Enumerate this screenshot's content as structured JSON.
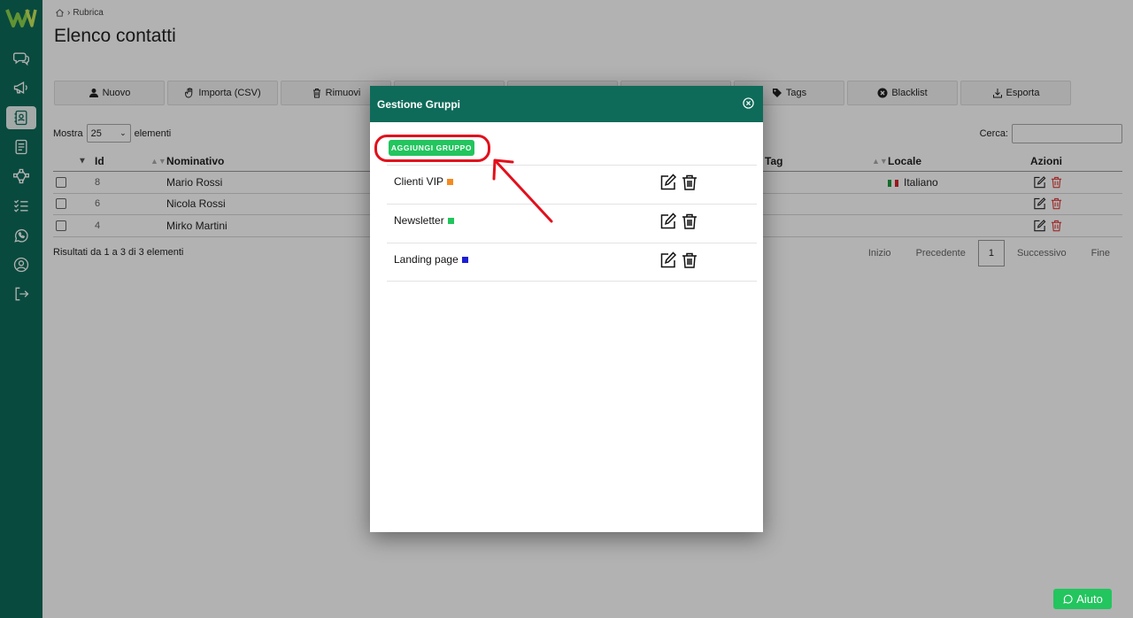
{
  "breadcrumb": {
    "current": "Rubrica"
  },
  "page": {
    "title": "Elenco contatti"
  },
  "toolbar": [
    {
      "label": "Nuovo",
      "icon": "user-icon"
    },
    {
      "label": "Importa (CSV)",
      "icon": "hand-icon"
    },
    {
      "label": "Rimuovi",
      "icon": "trash-icon"
    },
    {
      "label": "",
      "icon": ""
    },
    {
      "label": "",
      "icon": ""
    },
    {
      "label": "",
      "icon": ""
    },
    {
      "label": "Tags",
      "icon": "tag-icon"
    },
    {
      "label": "Blacklist",
      "icon": "block-icon"
    },
    {
      "label": "Esporta",
      "icon": "download-icon"
    }
  ],
  "list_controls": {
    "show_label": "Mostra",
    "page_size": "25",
    "elements_label": "elementi",
    "search_label": "Cerca:"
  },
  "table": {
    "headers": {
      "id": "Id",
      "name": "Nominativo",
      "tag": "Tag",
      "locale": "Locale",
      "actions": "Azioni"
    },
    "rows": [
      {
        "id": "8",
        "name": "Mario Rossi",
        "locale": "Italiano"
      },
      {
        "id": "6",
        "name": "Nicola Rossi",
        "locale": ""
      },
      {
        "id": "4",
        "name": "Mirko Martini",
        "locale": ""
      }
    ]
  },
  "results_text": "Risultati da 1 a 3 di 3 elementi",
  "pagination": {
    "first": "Inizio",
    "prev": "Precedente",
    "current": "1",
    "next": "Successivo",
    "last": "Fine"
  },
  "modal": {
    "title": "Gestione Gruppi",
    "add_button": "AGGIUNGI GRUPPO",
    "groups": [
      {
        "name": "Clienti VIP",
        "color": "#f58a1f"
      },
      {
        "name": "Newsletter",
        "color": "#22c55e"
      },
      {
        "name": "Landing page",
        "color": "#1d1dd6"
      }
    ]
  },
  "help": {
    "label": "Aiuto"
  },
  "colors": {
    "brand": "#0e6b59",
    "accent": "#22c55e",
    "highlight": "#e2101c",
    "delete": "#e23b3b"
  }
}
